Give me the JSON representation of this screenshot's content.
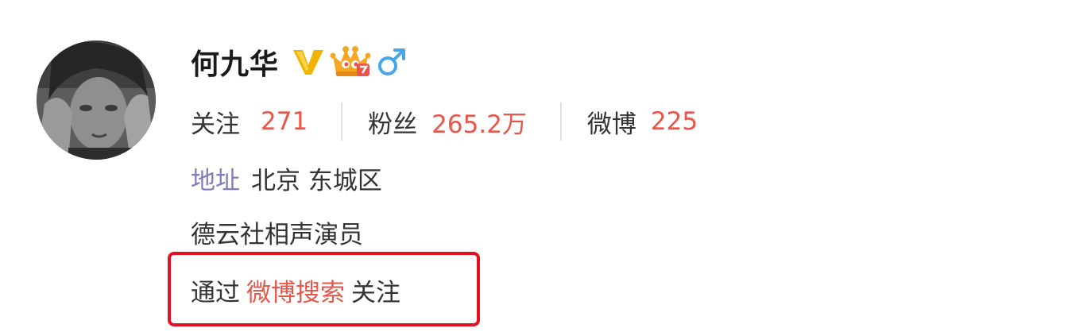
{
  "profile": {
    "name": "何九华",
    "badges": {
      "verified": {
        "icon": "verified-v-icon",
        "color": "#f0b400"
      },
      "membership": {
        "icon": "crown-membership-icon",
        "color": "#f0a01c"
      },
      "gender": {
        "icon": "male-gender-icon",
        "color": "#4aa5e8"
      }
    },
    "avatar": {
      "icon": "avatar-photo"
    }
  },
  "stats": [
    {
      "label": "关注",
      "value": "271"
    },
    {
      "label": "粉丝",
      "value": "265.2万"
    },
    {
      "label": "微博",
      "value": "225"
    }
  ],
  "address": {
    "label": "地址",
    "value": "北京 东城区"
  },
  "bio": "德云社相声演员",
  "follow_via": {
    "prefix": "通过",
    "link": "微博搜索",
    "suffix": "关注"
  },
  "colors": {
    "accent": "#e8564a",
    "address_label": "#7d7dbb",
    "highlight_border": "#e5101f"
  }
}
